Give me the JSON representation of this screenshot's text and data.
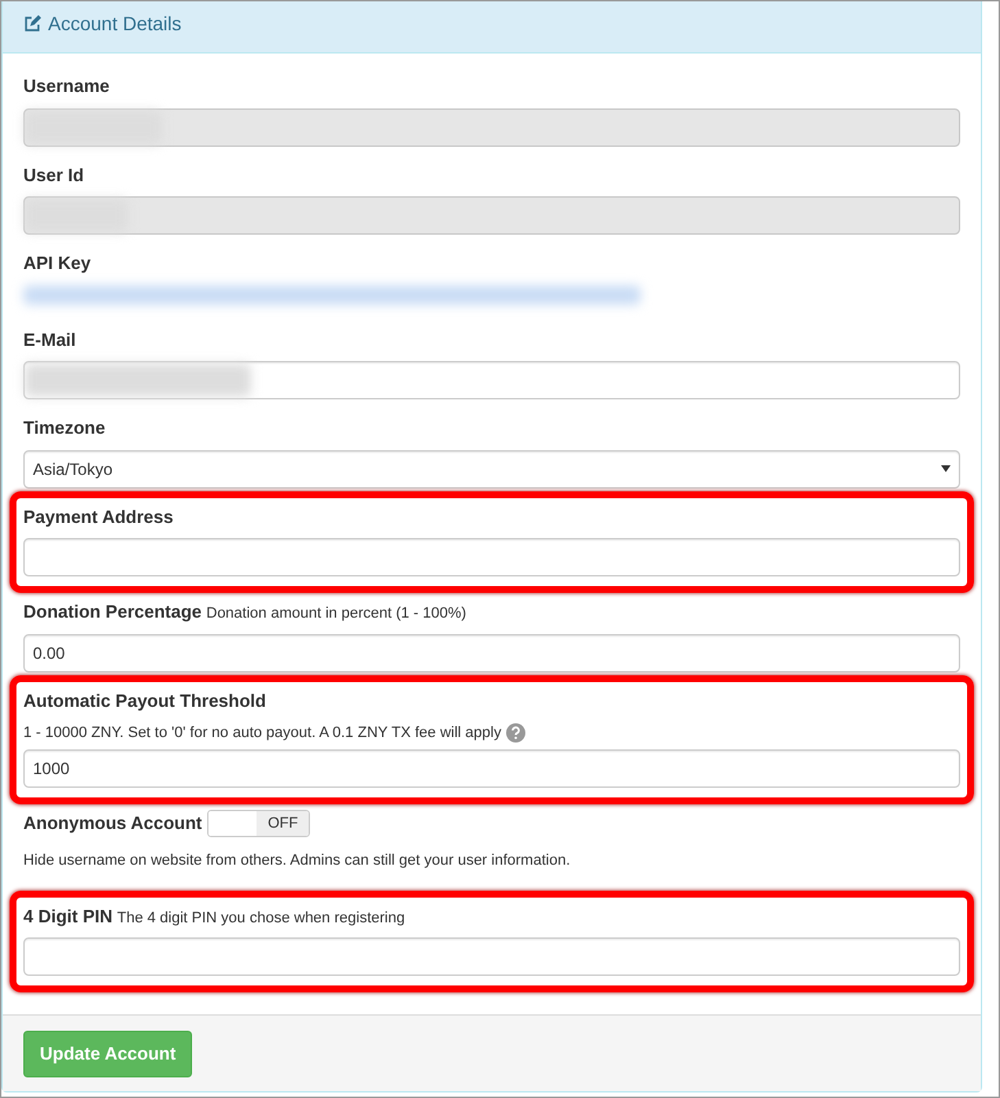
{
  "panel": {
    "title": "Account Details"
  },
  "fields": [
    {
      "kind": "input",
      "label": "Username",
      "readonly": true,
      "redacted": true,
      "highlighted": false
    },
    {
      "kind": "input",
      "label": "User Id",
      "readonly": true,
      "redacted": true,
      "highlighted": false
    },
    {
      "kind": "plain",
      "label": "API Key",
      "redacted": true,
      "highlighted": false
    },
    {
      "kind": "input",
      "label": "E-Mail",
      "readonly": false,
      "redacted": true,
      "highlighted": false
    },
    {
      "kind": "select",
      "label": "Timezone",
      "value": "Asia/Tokyo",
      "highlighted": false
    },
    {
      "kind": "input",
      "label": "Payment Address",
      "readonly": false,
      "highlighted": true
    },
    {
      "kind": "input",
      "label": "Donation Percentage",
      "hint": "Donation amount in percent (1 - 100%)",
      "readonly": false,
      "value": "0.00",
      "highlighted": false
    },
    {
      "kind": "input",
      "label": "Automatic Payout Threshold",
      "help": "1 - 10000 ZNY. Set to '0' for no auto payout. A 0.1 ZNY TX fee will apply",
      "readonly": false,
      "value": "1000",
      "highlighted": true
    },
    {
      "kind": "toggle",
      "label": "Anonymous Account",
      "toggle_text": "OFF",
      "on": false,
      "help": "Hide username on website from others. Admins can still get your user information.",
      "highlighted": false
    },
    {
      "kind": "input",
      "label": "4 Digit PIN",
      "hint": "The 4 digit PIN you chose when registering",
      "readonly": false,
      "highlighted": true
    }
  ],
  "submit": "Update Account"
}
